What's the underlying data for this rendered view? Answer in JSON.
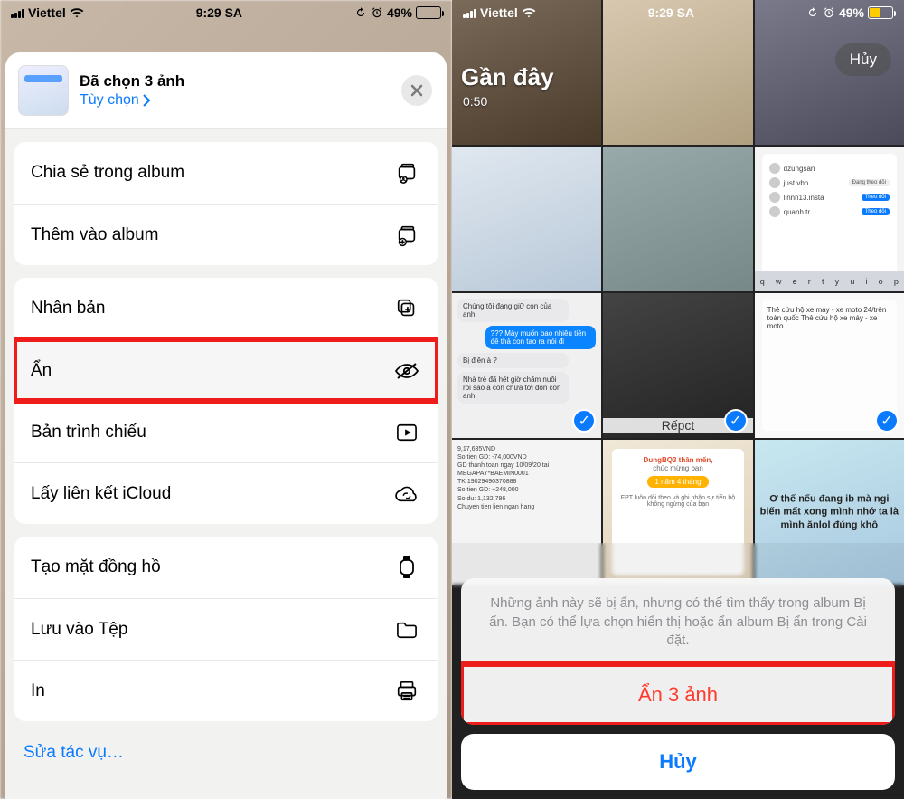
{
  "status": {
    "carrier": "Viettel",
    "time": "9:29 SA",
    "battery_pct": "49%",
    "battery_fill": "49%"
  },
  "left": {
    "title": "Đã chọn 3 ảnh",
    "options": "Tùy chọn",
    "edit_actions": "Sửa tác vụ…",
    "groups": [
      [
        {
          "label": "Chia sẻ trong album",
          "icon": "album-share-icon"
        },
        {
          "label": "Thêm vào album",
          "icon": "album-add-icon"
        }
      ],
      [
        {
          "label": "Nhân bản",
          "icon": "duplicate-icon"
        },
        {
          "label": "Ẩn",
          "icon": "hide-icon",
          "highlight": true
        },
        {
          "label": "Bản trình chiếu",
          "icon": "slideshow-icon"
        },
        {
          "label": "Lấy liên kết iCloud",
          "icon": "icloud-link-icon"
        }
      ],
      [
        {
          "label": "Tạo mặt đồng hồ",
          "icon": "watchface-icon"
        },
        {
          "label": "Lưu vào Tệp",
          "icon": "save-files-icon"
        },
        {
          "label": "In",
          "icon": "print-icon"
        }
      ]
    ]
  },
  "right": {
    "cancel": "Hủy",
    "recent_label": "Gần đây",
    "recent_time": "0:50",
    "repct": "Rếpct",
    "sheet_msg": "Những ảnh này sẽ bị ẩn, nhưng có thể tìm thấy trong album Bị ẩn. Bạn có thể lựa chọn hiển thị hoặc ẩn album Bị ẩn trong Cài đặt.",
    "sheet_action": "Ẩn 3 ảnh",
    "sheet_cancel": "Hủy",
    "keyboard_row": [
      "q",
      "w",
      "e",
      "r",
      "t",
      "y",
      "u",
      "i",
      "o",
      "p"
    ],
    "insta_users": [
      "dzungsan",
      "just.vbn",
      "linnn13.insta",
      "quanh.tr"
    ],
    "follow_following": "Đang theo dõi",
    "follow_follow": "Theo dõi",
    "chat_msgs": [
      "Chúng tôi đang giữ con của anh",
      "??? Mày muốn bao nhiêu tiền để thả con tao ra nói đi",
      "Bị điên à ?",
      "Nhà trẻ đã hết giờ chăm nuôi rồi sao a còn chưa tới đón con anh"
    ],
    "bank_lines": [
      "9,17,635VND",
      "So tien GD: -74,000VND",
      "GD thanh toan ngay 10/09/20 tai MEGAPAY*BAEMIN0001",
      "TK 19029490370888",
      "So tien GD: +248,000",
      "So du: 1,132,786",
      "Chuyen tien lien ngan hang"
    ],
    "promo_name": "DungBQ3 thân mến,",
    "promo_sub": "chúc mừng bạn",
    "promo_time": "1 năm 4 tháng",
    "promo_foot": "FPT luôn dõi theo và ghi nhận sự tiến bộ không ngừng của bạn",
    "card_caption": "Thẻ cứu hộ xe máy - xe moto 24/trên toàn quốc\nThẻ cứu hộ xe máy - xe moto",
    "green_caption": "Ơ thế nếu đang ib mà ngi biến mất xong mình nhớ ta là mình ănlol đúng khô"
  }
}
